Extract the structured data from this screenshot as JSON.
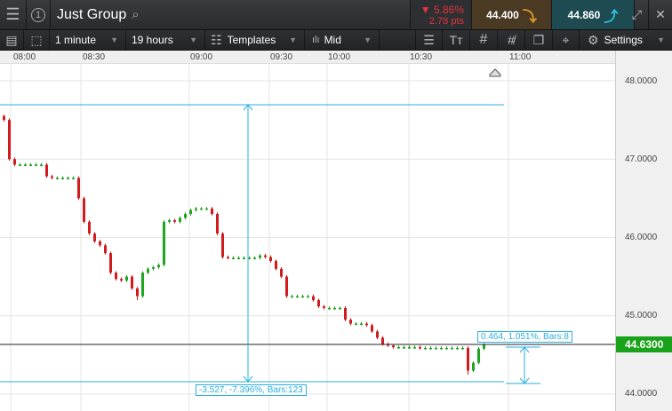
{
  "header": {
    "instrument": "Just Group",
    "change_pct": "▼ 5.86%",
    "change_pts": "2.78 pts",
    "sell_price": "44.400",
    "buy_price": "44.860",
    "circle_number": "1"
  },
  "toolbar": {
    "interval": "1 minute",
    "span": "19 hours",
    "templates": "Templates",
    "price_type": "Mid",
    "settings": "Settings"
  },
  "time_axis": [
    "08:00",
    "08:30",
    "09:00",
    "09:30",
    "10:00",
    "10:30",
    "11:00"
  ],
  "price_axis": [
    "48.0000",
    "47.0000",
    "46.0000",
    "45.0000",
    "44.0000"
  ],
  "current_price": "44.6300",
  "measurements": [
    {
      "label": "-3.527, -7.396%, Bars:123",
      "from": 47.69,
      "to": 44.16
    },
    {
      "label": "0.464, 1.051%, Bars:8",
      "from": 44.16,
      "to": 44.62
    }
  ],
  "colors": {
    "up": "#1fa51f",
    "down": "#d01c1c",
    "measure": "#29aee0",
    "price_badge": "#1aa21a"
  },
  "candles_close": [
    47.5,
    47.0,
    46.93,
    46.93,
    46.93,
    46.93,
    46.93,
    46.93,
    46.78,
    46.76,
    46.76,
    46.76,
    46.76,
    46.76,
    46.5,
    46.2,
    46.05,
    45.95,
    45.9,
    45.8,
    45.55,
    45.47,
    45.45,
    45.5,
    45.35,
    45.25,
    45.55,
    45.6,
    45.62,
    45.65,
    46.2,
    46.22,
    46.2,
    46.25,
    46.3,
    46.35,
    46.37,
    46.37,
    46.37,
    46.3,
    46.05,
    45.75,
    45.74,
    45.74,
    45.74,
    45.74,
    45.74,
    45.74,
    45.77,
    45.75,
    45.7,
    45.6,
    45.5,
    45.25,
    45.25,
    45.25,
    45.25,
    45.25,
    45.2,
    45.12,
    45.1,
    45.1,
    45.1,
    45.1,
    44.95,
    44.9,
    44.9,
    44.9,
    44.88,
    44.8,
    44.72,
    44.64,
    44.62,
    44.6,
    44.6,
    44.6,
    44.6,
    44.6,
    44.59,
    44.59,
    44.59,
    44.59,
    44.59,
    44.59,
    44.59,
    44.59,
    44.59,
    44.3,
    44.4,
    44.58,
    44.63
  ]
}
